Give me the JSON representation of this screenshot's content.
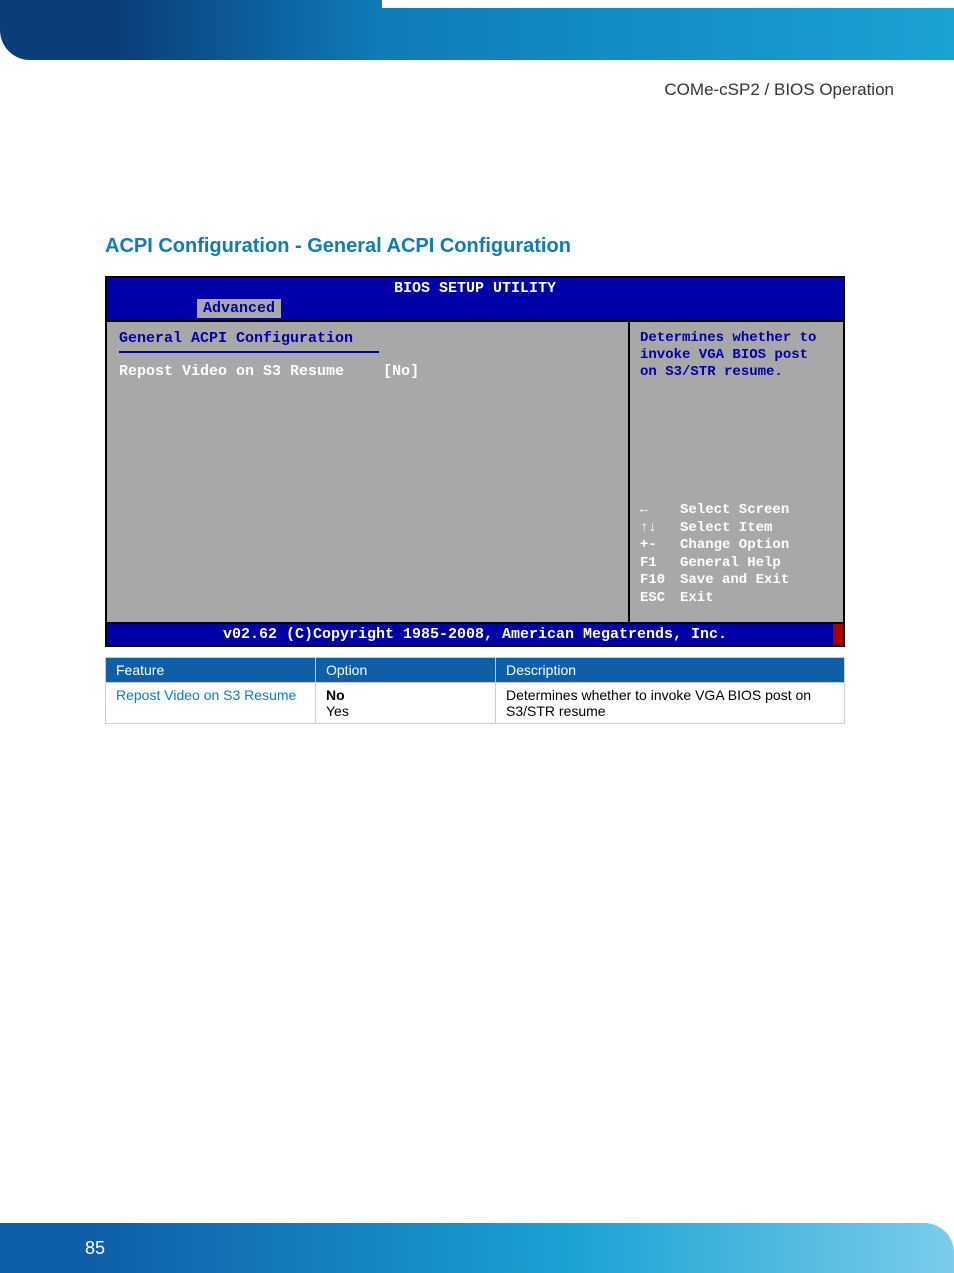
{
  "header": {
    "breadcrumb": "COMe-cSP2 / BIOS Operation"
  },
  "section": {
    "title": "ACPI Configuration - General ACPI Configuration"
  },
  "bios": {
    "title": "BIOS SETUP UTILITY",
    "tab": "Advanced",
    "left": {
      "heading": "General ACPI Configuration",
      "row_label": "Repost Video on S3 Resume",
      "row_value": "[No]"
    },
    "right": {
      "help1": "Determines whether to",
      "help2": "invoke VGA BIOS post",
      "help3": "on S3/STR resume.",
      "nav": [
        {
          "key": "←",
          "action": "Select Screen"
        },
        {
          "key": "↑↓",
          "action": "Select Item"
        },
        {
          "key": "+-",
          "action": "Change Option"
        },
        {
          "key": "F1",
          "action": "General Help"
        },
        {
          "key": "F10",
          "action": "Save and Exit"
        },
        {
          "key": "ESC",
          "action": "Exit"
        }
      ]
    },
    "footer": "v02.62 (C)Copyright 1985-2008, American Megatrends, Inc."
  },
  "table": {
    "headers": {
      "feature": "Feature",
      "option": "Option",
      "description": "Description"
    },
    "rows": [
      {
        "feature": "Repost Video on S3 Resume",
        "option_bold": "No",
        "option_other": "Yes",
        "description": "Determines whether to invoke VGA BIOS post on S3/STR resume"
      }
    ]
  },
  "page": {
    "number": "85"
  }
}
